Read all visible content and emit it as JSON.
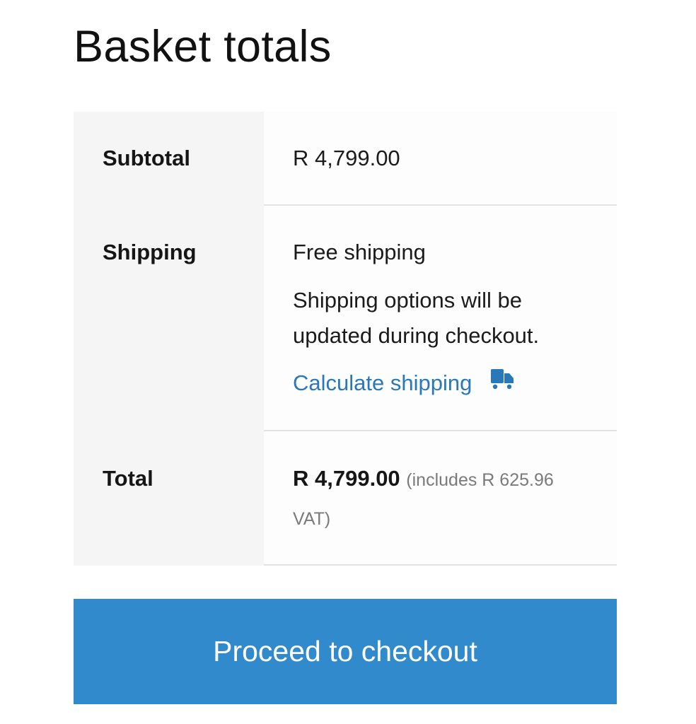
{
  "page": {
    "title": "Basket totals"
  },
  "totals": {
    "subtotal_label": "Subtotal",
    "subtotal_value": "R 4,799.00",
    "shipping_label": "Shipping",
    "shipping_method": "Free shipping",
    "shipping_note_line1": "Shipping options will be",
    "shipping_note_line2": "updated during checkout.",
    "calculate_shipping_label": "Calculate shipping",
    "calculate_shipping_icon": "truck-icon",
    "total_label": "Total",
    "total_value": "R 4,799.00",
    "total_includes_line1": "(includes R 625.96",
    "total_includes_line2": "VAT)"
  },
  "actions": {
    "checkout_label": "Proceed to checkout"
  },
  "colors": {
    "accent": "#318acb",
    "link": "#2a78b8",
    "label_bg": "#f5f5f5",
    "muted_text": "#7a7a7a"
  }
}
